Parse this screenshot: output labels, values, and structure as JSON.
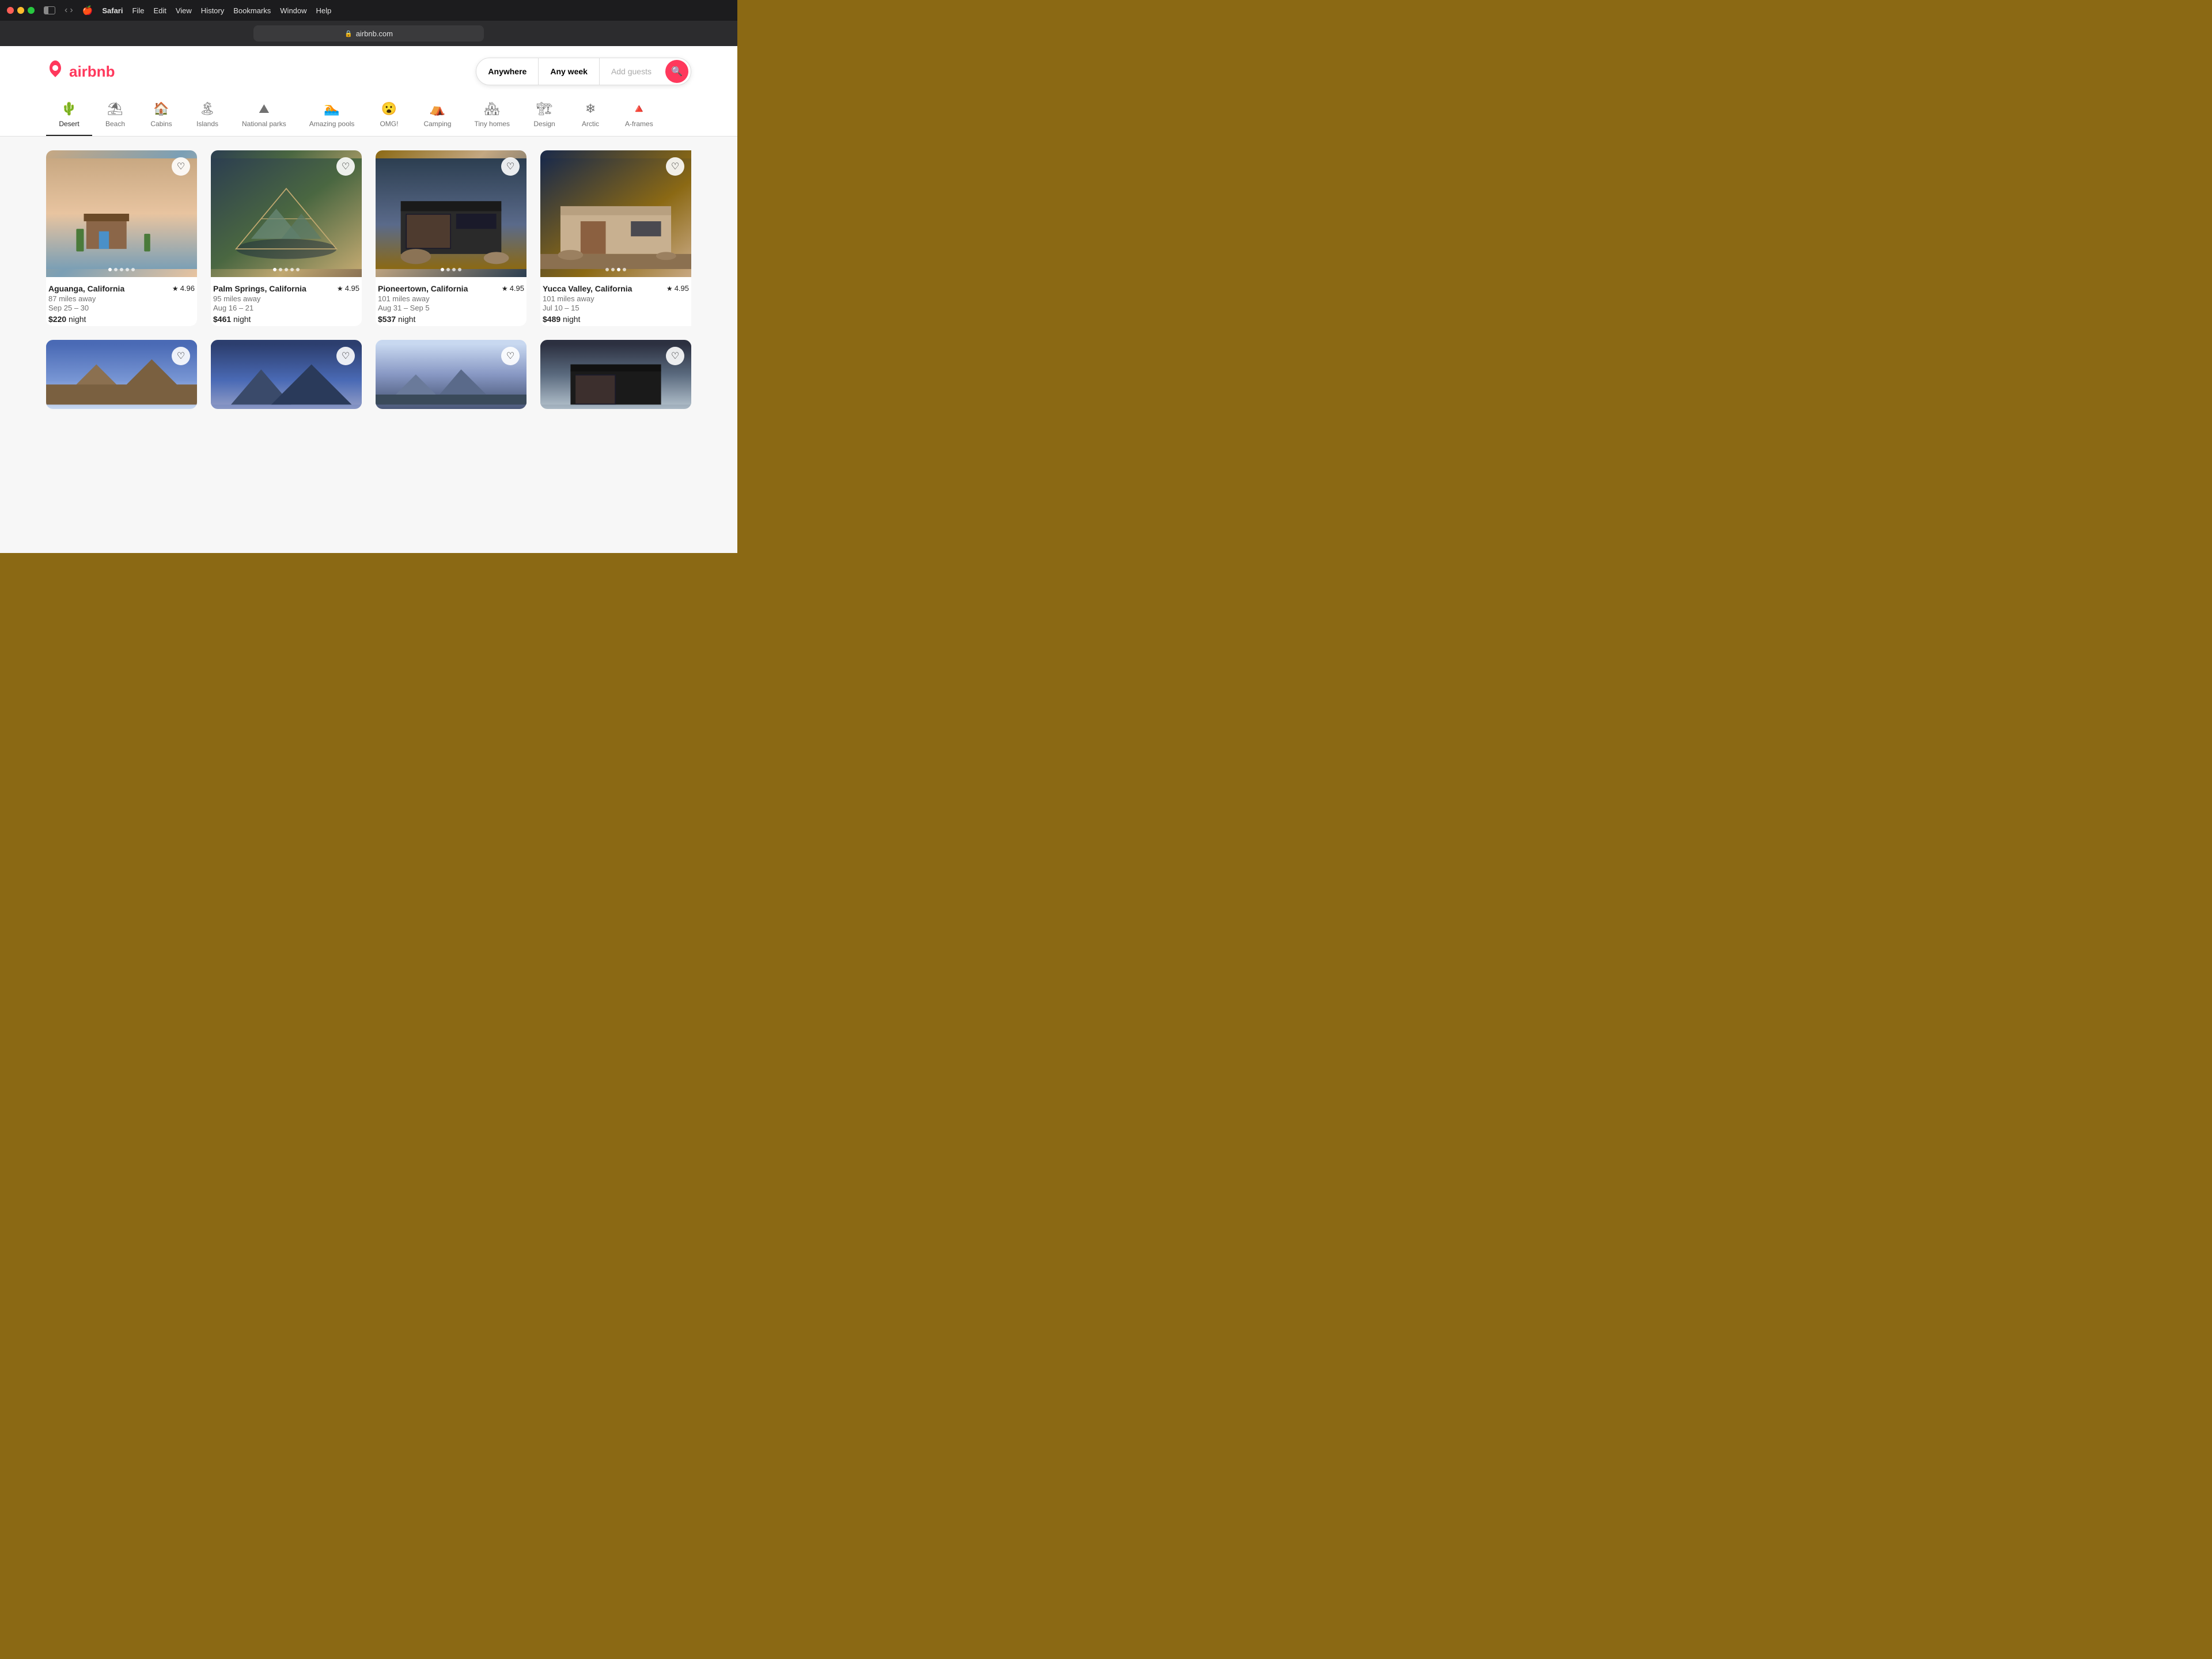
{
  "browser": {
    "menu_items": [
      "🍎",
      "Safari",
      "File",
      "Edit",
      "View",
      "History",
      "Bookmarks",
      "Window",
      "Help"
    ],
    "url": "airbnb.com",
    "lock_icon": "🔒"
  },
  "header": {
    "logo_text": "airbnb",
    "search": {
      "anywhere": "Anywhere",
      "any_week": "Any week",
      "add_guests": "Add guests"
    }
  },
  "categories": [
    {
      "id": "desert",
      "label": "Desert",
      "icon": "🌵",
      "active": true
    },
    {
      "id": "beach",
      "label": "Beach",
      "icon": "⛱",
      "active": false
    },
    {
      "id": "cabins",
      "label": "Cabins",
      "icon": "🏠",
      "active": false
    },
    {
      "id": "islands",
      "label": "Islands",
      "icon": "🏝",
      "active": false
    },
    {
      "id": "national-parks",
      "label": "National parks",
      "icon": "⛰",
      "active": false
    },
    {
      "id": "amazing-pools",
      "label": "Amazing pools",
      "icon": "🏊",
      "active": false
    },
    {
      "id": "omg",
      "label": "OMG!",
      "icon": "😮",
      "active": false
    },
    {
      "id": "camping",
      "label": "Camping",
      "icon": "⛺",
      "active": false
    },
    {
      "id": "tiny-homes",
      "label": "Tiny homes",
      "icon": "🏘",
      "active": false
    },
    {
      "id": "design",
      "label": "Design",
      "icon": "🏗",
      "active": false
    },
    {
      "id": "arctic",
      "label": "Arctic",
      "icon": "❄",
      "active": false
    },
    {
      "id": "a-frames",
      "label": "A-frames",
      "icon": "🔺",
      "active": false
    }
  ],
  "listings": [
    {
      "id": 1,
      "location": "Aguanga, California",
      "rating": "4.96",
      "distance": "87 miles away",
      "dates": "Sep 25 – 30",
      "price": "$220",
      "price_unit": "night",
      "card_class": "card-1"
    },
    {
      "id": 2,
      "location": "Palm Springs, California",
      "rating": "4.95",
      "distance": "95 miles away",
      "dates": "Aug 16 – 21",
      "price": "$461",
      "price_unit": "night",
      "card_class": "card-2"
    },
    {
      "id": 3,
      "location": "Pioneertown, California",
      "rating": "4.95",
      "distance": "101 miles away",
      "dates": "Aug 31 – Sep 5",
      "price": "$537",
      "price_unit": "night",
      "card_class": "card-3"
    },
    {
      "id": 4,
      "location": "Yucca Valley, California",
      "rating": "4.95",
      "distance": "101 miles away",
      "dates": "Jul 10 – 15",
      "price": "$489",
      "price_unit": "night",
      "card_class": "card-4"
    },
    {
      "id": 5,
      "location": "",
      "rating": "",
      "distance": "",
      "dates": "",
      "price": "",
      "price_unit": "",
      "card_class": "card-5"
    },
    {
      "id": 6,
      "location": "",
      "rating": "",
      "distance": "",
      "dates": "",
      "price": "",
      "price_unit": "",
      "card_class": "card-6"
    },
    {
      "id": 7,
      "location": "",
      "rating": "",
      "distance": "",
      "dates": "",
      "price": "",
      "price_unit": "",
      "card_class": "card-7"
    },
    {
      "id": 8,
      "location": "",
      "rating": "",
      "distance": "",
      "dates": "",
      "price": "",
      "price_unit": "",
      "card_class": "card-8"
    }
  ],
  "colors": {
    "airbnb_red": "#FF385C",
    "text_dark": "#222222",
    "text_gray": "#717171"
  }
}
